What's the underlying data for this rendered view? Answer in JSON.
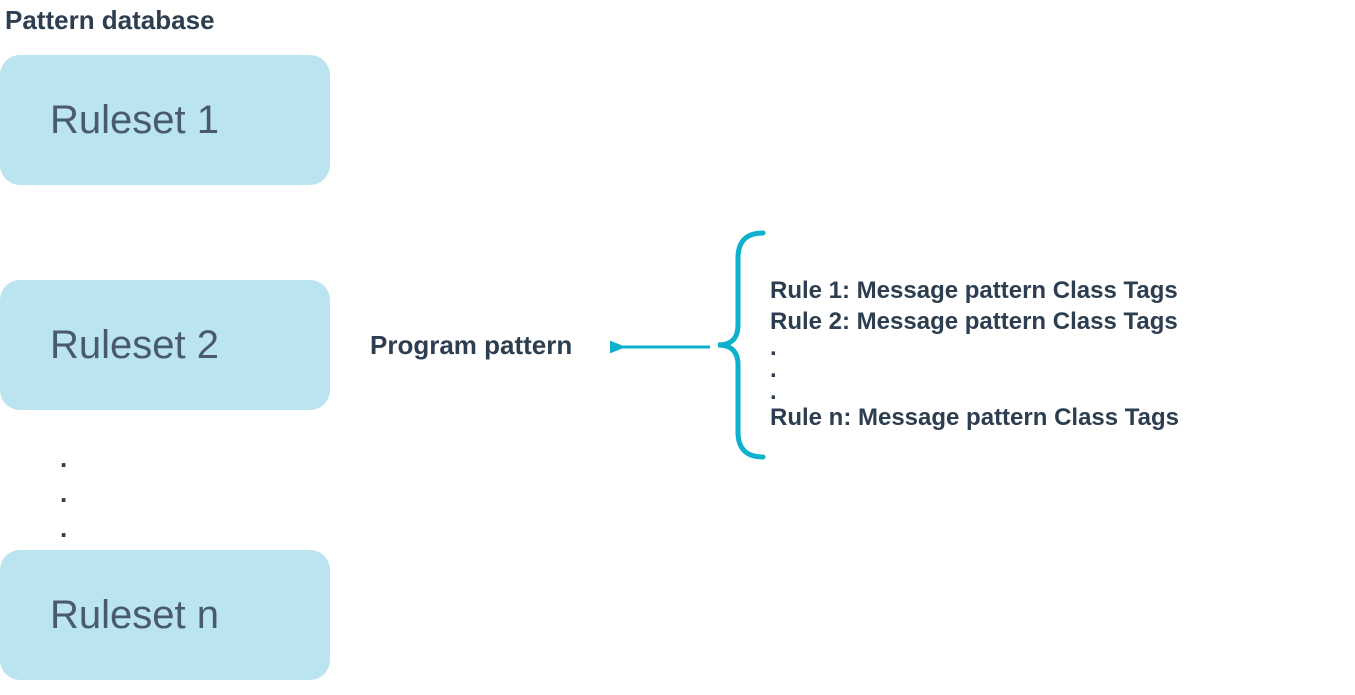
{
  "title": "Pattern database",
  "rulesets": {
    "r1": "Ruleset 1",
    "r2": "Ruleset 2",
    "rn": "Ruleset n"
  },
  "program_pattern_label": "Program pattern",
  "rules": {
    "r1": "Rule 1: Message pattern Class Tags",
    "r2": "Rule 2: Message pattern Class Tags",
    "rn": "Rule n: Message pattern Class Tags"
  },
  "colors": {
    "box_bg": "#bae4ef",
    "text": "#2c3e50",
    "box_text": "#495a6b",
    "accent": "#0db0cd"
  }
}
